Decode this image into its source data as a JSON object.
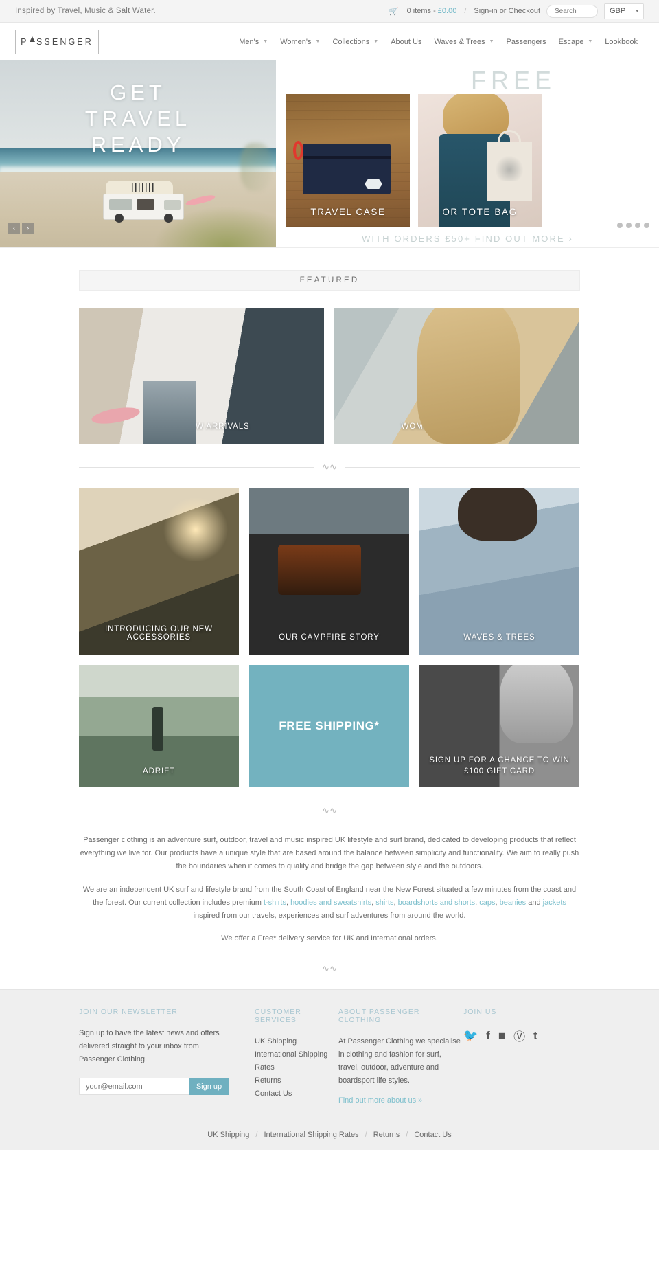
{
  "topbar": {
    "tagline": "Inspired by Travel, Music & Salt Water.",
    "cart_icon": "cart-icon",
    "cart_text": "0 items - ",
    "cart_price": "£0.00",
    "separator": "/",
    "account_link": "Sign-in or Checkout",
    "search_placeholder": "Search",
    "currency_value": "GBP",
    "caret": "▾"
  },
  "header": {
    "logo_pre": "P",
    "logo_tri": "A",
    "logo_post": "SSENGER",
    "nav": [
      {
        "label": "Men's",
        "has_dropdown": true
      },
      {
        "label": "Women's",
        "has_dropdown": true
      },
      {
        "label": "Collections",
        "has_dropdown": true
      },
      {
        "label": "About Us",
        "has_dropdown": false
      },
      {
        "label": "Waves & Trees",
        "has_dropdown": true
      },
      {
        "label": "Passengers",
        "has_dropdown": false
      },
      {
        "label": "Escape",
        "has_dropdown": true
      },
      {
        "label": "Lookbook",
        "has_dropdown": false
      }
    ]
  },
  "hero": {
    "title_line1": "GET",
    "title_line2": "TRAVEL",
    "title_line3": "READY",
    "prev_arrow": "‹",
    "next_arrow": "›",
    "free_word": "FREE",
    "promo1_caption": "TRAVEL CASE",
    "promo2_caption": "OR TOTE BAG",
    "subline": "WITH ORDERS £50+ FIND OUT MORE ›",
    "dots": 4,
    "active_dot": 0
  },
  "featured": {
    "heading": "FEATURED",
    "row_top": [
      {
        "caption": "MEN'S NEW ARRIVALS",
        "name": "tile-mens-new-arrivals"
      },
      {
        "caption": "WOMEN'S NEW ARRIVALS",
        "name": "tile-womens-new-arrivals"
      }
    ],
    "row_mid": [
      {
        "caption": "INTRODUCING OUR NEW ACCESSORIES",
        "name": "tile-new-accessories"
      },
      {
        "caption": "OUR CAMPFIRE STORY",
        "name": "tile-campfire-story"
      },
      {
        "caption": "WAVES & TREES",
        "name": "tile-waves-and-trees"
      }
    ],
    "row_bottom": [
      {
        "caption": "ADRIFT",
        "name": "tile-adrift"
      },
      {
        "caption": "FREE SHIPPING*",
        "name": "tile-free-shipping"
      },
      {
        "caption": "SIGN UP FOR A CHANCE TO WIN £100 GIFT CARD",
        "name": "tile-gift-card"
      }
    ]
  },
  "about": {
    "p1": "Passenger clothing is an adventure surf, outdoor, travel and music inspired UK lifestyle and surf brand, dedicated to developing products that reflect everything we live for. Our products have a unique style that are based around the balance between simplicity and functionality. We aim to really push the boundaries when it comes to quality and bridge the gap between style and the outdoors.",
    "p2_a": "We are an independent UK surf and lifestyle brand from the South Coast of England near the New Forest situated a few minutes from the coast and the forest. Our current collection includes premium ",
    "p2_links": [
      "t-shirts",
      "hoodies and sweatshirts",
      "shirts",
      "boardshorts and shorts",
      "caps",
      "beanies",
      "jackets"
    ],
    "p2_b": " inspired from our travels, experiences and surf adventures from around the world.",
    "p3": "We offer a Free* delivery service for UK and International orders."
  },
  "footer": {
    "newsletter": {
      "heading": "JOIN OUR NEWSLETTER",
      "body": "Sign up to have the latest news and offers delivered straight to your inbox from Passenger Clothing.",
      "placeholder": "your@email.com",
      "button": "Sign up"
    },
    "customer_services": {
      "heading": "CUSTOMER SERVICES",
      "links": [
        "UK Shipping",
        "International Shipping Rates",
        "Returns",
        "Contact Us"
      ]
    },
    "about_col": {
      "heading": "ABOUT PASSENGER CLOTHING",
      "body": "At Passenger Clothing we specialise in clothing and fashion for surf, travel, outdoor, adventure and boardsport life styles.",
      "more": "Find out more about us »"
    },
    "join_us": {
      "heading": "JOIN US",
      "icons": [
        "twitter-icon",
        "facebook-icon",
        "instagram-icon",
        "pinterest-icon",
        "tumblr-icon"
      ],
      "glyphs": [
        "𝐓",
        "f",
        "▣",
        "ⓟ",
        "t"
      ]
    },
    "bottom_links": [
      "UK Shipping",
      "International Shipping Rates",
      "Returns",
      "Contact Us"
    ],
    "bottom_sep": "/"
  },
  "colors": {
    "accent": "#6fb0c0",
    "link": "#7fc0cd",
    "footer_bg": "#efefef"
  }
}
